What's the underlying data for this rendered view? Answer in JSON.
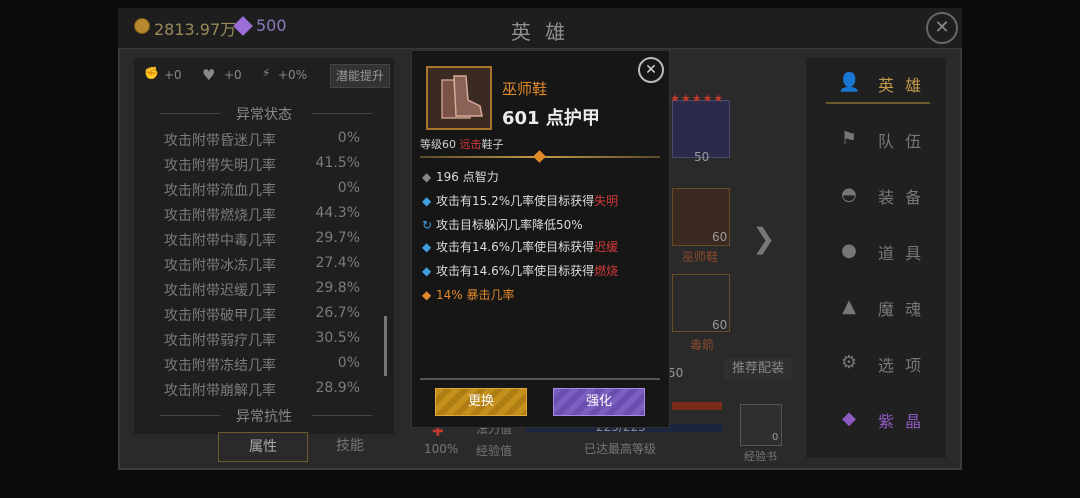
{
  "header": {
    "gold": "2813.97万",
    "gems": "500",
    "title": "英 雄"
  },
  "left_panel": {
    "top_stats": [
      "+0",
      "+0",
      "+0%"
    ],
    "potential_button": "潜能提升",
    "section_abnormal_status": "异常状态",
    "rows": [
      {
        "label": "攻击附带昏迷几率",
        "value": "0%"
      },
      {
        "label": "攻击附带失明几率",
        "value": "41.5%"
      },
      {
        "label": "攻击附带流血几率",
        "value": "0%"
      },
      {
        "label": "攻击附带燃烧几率",
        "value": "44.3%"
      },
      {
        "label": "攻击附带中毒几率",
        "value": "29.7%"
      },
      {
        "label": "攻击附带冰冻几率",
        "value": "27.4%"
      },
      {
        "label": "攻击附带迟缓几率",
        "value": "29.8%"
      },
      {
        "label": "攻击附带破甲几率",
        "value": "26.7%"
      },
      {
        "label": "攻击附带弱疗几率",
        "value": "30.5%"
      },
      {
        "label": "攻击附带冻结几率",
        "value": "0%"
      },
      {
        "label": "攻击附带崩解几率",
        "value": "28.9%"
      }
    ],
    "section_abnormal_resist": "异常抗性",
    "tabs": {
      "attributes": "属性",
      "skills": "技能"
    }
  },
  "nav": [
    {
      "label": "英 雄",
      "icon": "hero-icon"
    },
    {
      "label": "队 伍",
      "icon": "flag-icon"
    },
    {
      "label": "装 备",
      "icon": "helmet-icon"
    },
    {
      "label": "道 具",
      "icon": "bag-icon"
    },
    {
      "label": "魔 魂",
      "icon": "flame-icon"
    },
    {
      "label": "选 项",
      "icon": "gear-icon"
    },
    {
      "label": "紫 晶",
      "icon": "crystal-icon"
    }
  ],
  "background": {
    "slot1_level": "50",
    "slot2_level": "60",
    "slot2_name": "巫师鞋",
    "slot3_level": "60",
    "slot3_name": "毒箭",
    "recommend": "推荐配装",
    "mana_label": "法力值",
    "mana_value": "225/225",
    "exp_label": "经验值",
    "exp_value": "已达最高等级",
    "percent": "100%",
    "exp_book": "经验书",
    "exp_book_count": "0",
    "hidden_level": "50"
  },
  "tooltip": {
    "name": "巫师鞋",
    "armor": "601 点护甲",
    "level_prefix": "等级60 ",
    "level_type": "远击",
    "level_suffix": "鞋子",
    "lines": [
      {
        "pre": "196 点智力",
        "red": "",
        "marker": "◆",
        "kind": "grey"
      },
      {
        "pre": "攻击有15.2%几率使目标获得",
        "red": "失明",
        "marker": "◆",
        "kind": "blue"
      },
      {
        "pre": "攻击目标躲闪几率降低50%",
        "red": "",
        "marker": "↻",
        "kind": "blue"
      },
      {
        "pre": "攻击有14.6%几率使目标获得",
        "red": "迟缓",
        "marker": "◆",
        "kind": "blue"
      },
      {
        "pre": "攻击有14.6%几率使目标获得",
        "red": "燃烧",
        "marker": "◆",
        "kind": "blue"
      },
      {
        "pre": "14% 暴击几率",
        "red": "",
        "marker": "◆",
        "kind": "orange"
      }
    ],
    "btn_change": "更换",
    "btn_enhance": "强化"
  }
}
